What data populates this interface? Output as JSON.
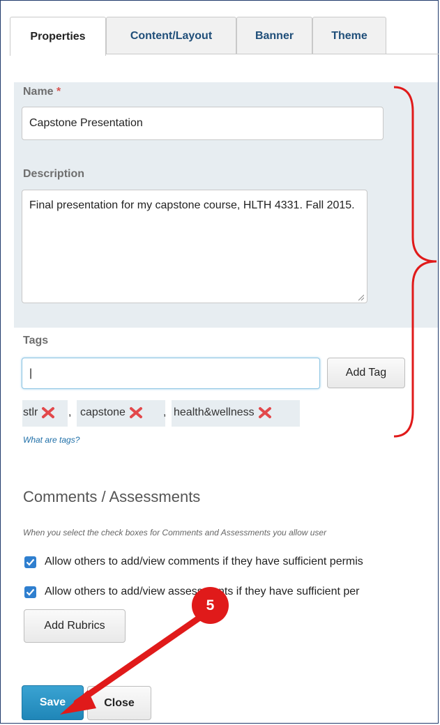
{
  "tabs": [
    {
      "label": "Properties",
      "active": true
    },
    {
      "label": "Content/Layout",
      "active": false
    },
    {
      "label": "Banner",
      "active": false
    },
    {
      "label": "Theme",
      "active": false
    }
  ],
  "form": {
    "name_label": "Name",
    "required_marker": "*",
    "name_value": "Capstone Presentation",
    "description_label": "Description",
    "description_value": "Final presentation for my capstone course, HLTH 4331. Fall 2015.",
    "tags_label": "Tags",
    "tags_input_value": "|",
    "add_tag_label": "Add Tag",
    "tags": [
      "stlr",
      "capstone",
      "health&wellness"
    ],
    "tag_separator": ",",
    "tags_help_link": "What are tags?"
  },
  "comments": {
    "title": "Comments / Assessments",
    "help_text": "When you select the check boxes for Comments and Assessments you allow user",
    "checkbox_comments": "Allow others to add/view comments if they have sufficient permis",
    "checkbox_assessments": "Allow others to add/view assessments if they have sufficient per",
    "comments_checked": true,
    "assessments_checked": true,
    "add_rubrics_label": "Add Rubrics"
  },
  "footer": {
    "save_label": "Save",
    "close_label": "Close"
  },
  "annotation": {
    "step_number": "5",
    "color": "#e01a1a"
  },
  "colors": {
    "accent": "#1f86b8",
    "link": "#1f6fa8",
    "shade": "#e7edf1"
  }
}
